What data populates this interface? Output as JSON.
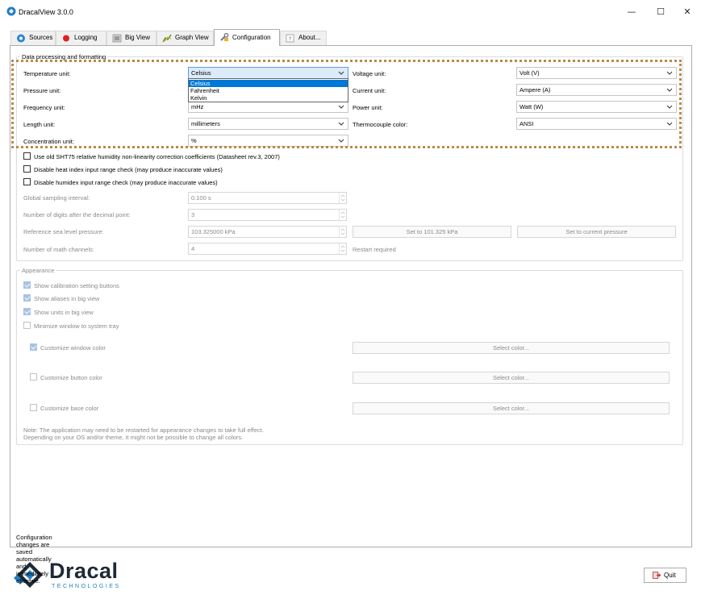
{
  "window": {
    "title": "DracalView 3.0.0",
    "minimize_glyph": "—",
    "maximize_glyph": "☐",
    "close_glyph": "✕"
  },
  "tabs": [
    {
      "label": "Sources",
      "icon": "sources-icon"
    },
    {
      "label": "Logging",
      "icon": "record-icon"
    },
    {
      "label": "Big View",
      "icon": "big-view-icon"
    },
    {
      "label": "Graph View",
      "icon": "graph-icon"
    },
    {
      "label": "Configuration",
      "icon": "wrench-icon",
      "active": true
    },
    {
      "label": "About...",
      "icon": "about-icon"
    }
  ],
  "data_processing": {
    "title": "Data processing and formatting",
    "temperature": {
      "label": "Temperature unit:",
      "value": "Celsius",
      "options": [
        "Celsius",
        "Fahrenheit",
        "Kelvin"
      ]
    },
    "pressure": {
      "label": "Pressure unit:"
    },
    "frequency": {
      "label": "Frequency unit:",
      "value": "mHz"
    },
    "length": {
      "label": "Length unit:",
      "value": "millimeters"
    },
    "concentration": {
      "label": "Concentration unit:",
      "value": "%"
    },
    "voltage": {
      "label": "Voltage unit:",
      "value": "Volt (V)"
    },
    "current": {
      "label": "Current unit:",
      "value": "Ampere (A)"
    },
    "power": {
      "label": "Power unit:",
      "value": "Watt (W)"
    },
    "thermocouple": {
      "label": "Thermocouple color:",
      "value": "ANSI"
    },
    "checks": {
      "old_sht75": "Use old SHT75 relative humidity non-linearity correction coefficients (Datasheet rev.3, 2007)",
      "heat_index": "Disable heat index input range check (may produce inaccurate values)",
      "humidex": "Disable humidex input range check (may produce inaccurate values)"
    },
    "sampling": {
      "label": "Global sampling interval:",
      "value": "0.100 s"
    },
    "digits": {
      "label": "Number of digits after the decimal point:",
      "value": "3"
    },
    "sea_level": {
      "label": "Reference sea level pressure:",
      "value": "103.325000 kPa",
      "set_button": "Set to 101.325 kPa",
      "current_button": "Set to current pressure"
    },
    "math_channels": {
      "label": "Number of math channels:",
      "value": "4",
      "note": "Restart required"
    }
  },
  "appearance": {
    "title": "Appearance",
    "show_calibration": "Show calibration setting buttons",
    "show_aliases": "Show aliases in big view",
    "show_units": "Show units in big view",
    "minimize_tray": "Minimize window to system tray",
    "window_color": "Customize window color",
    "button_color": "Customize button color",
    "base_color": "Customize base color",
    "select_color": "Select color...",
    "note_line1": "Note: The application may need to be restarted for appearance changes to take full effect.",
    "note_line2": "Depending on your OS and/or theme, it might not be possible to change all colors."
  },
  "footer": {
    "note": "Configuration changes are saved automatically and immediately effective.",
    "logo_name": "Dracal",
    "logo_sub": "TECHNOLOGIES",
    "quit": "Quit"
  },
  "colors": {
    "accent": "#0078d7",
    "logo_blue": "#1f7fc4",
    "logo_dark": "#1d2a36",
    "highlight_border": "#b8894a"
  }
}
